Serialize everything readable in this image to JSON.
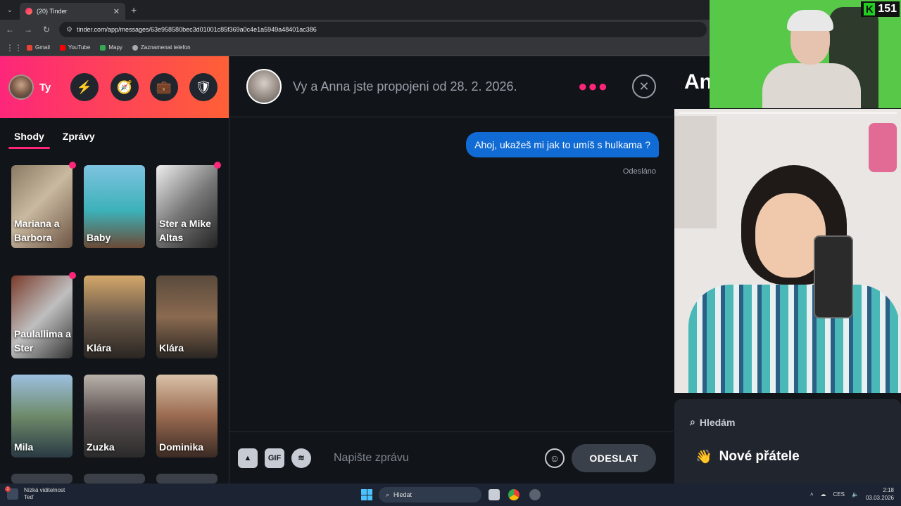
{
  "browser": {
    "tab_title": "(20) Tinder",
    "url": "tinder.com/app/messages/63e958580bec3d01001c85f369a0c4e1a5949a48401ac386",
    "bookmarks": [
      "Gmail",
      "YouTube",
      "Mapy",
      "Zaznamenat telefon"
    ]
  },
  "sidebar": {
    "user_label": "Ty",
    "tabs": [
      "Shody",
      "Zprávy"
    ],
    "matches": [
      {
        "name": "Mariana a Barbora",
        "new": true
      },
      {
        "name": "Baby",
        "new": false
      },
      {
        "name": "Ster a Mike Altas",
        "new": true
      },
      {
        "name": "Paulallima a Ster",
        "new": true
      },
      {
        "name": "Klára",
        "new": false
      },
      {
        "name": "Klára",
        "new": false
      },
      {
        "name": "Mila",
        "new": false
      },
      {
        "name": "Zuzka",
        "new": false
      },
      {
        "name": "Dominika",
        "new": false
      }
    ]
  },
  "chat": {
    "header": "Vy a Anna jste propojeni od 28. 2. 2026.",
    "message": "Ahoj, ukažeš mi jak to umíš s hulkama ?",
    "status": "Odesláno",
    "input_placeholder": "Napište zprávu",
    "gif_label": "GIF",
    "send_label": "ODESLAT"
  },
  "profile": {
    "name": "An",
    "looking_for_label": "Hledám",
    "looking_for_value": "Nové přátele",
    "looking_for_emoji": "👋"
  },
  "overlay": {
    "badge_count": "151",
    "badge_letter": "K"
  },
  "taskbar": {
    "notification_title": "Nízká viditelnost",
    "notification_sub": "Teď",
    "notification_count": "1",
    "search_label": "Hledat",
    "lang": "CES",
    "time": "2:18",
    "date": "03.03.2026"
  },
  "colors": {
    "accent": "#fd267a",
    "bubble": "#106bd5",
    "background": "#111418"
  }
}
